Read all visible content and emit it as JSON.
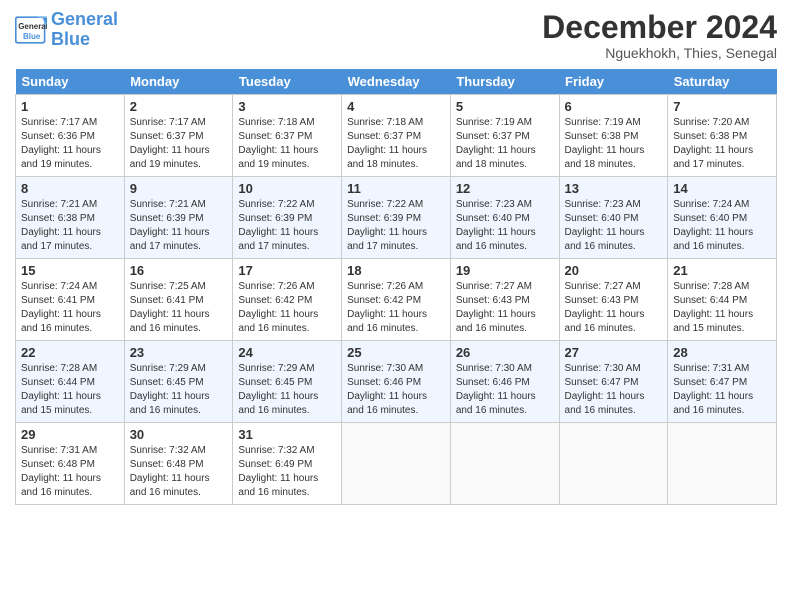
{
  "header": {
    "logo_line1": "General",
    "logo_line2": "Blue",
    "month_title": "December 2024",
    "location": "Nguekhokh, Thies, Senegal"
  },
  "days_of_week": [
    "Sunday",
    "Monday",
    "Tuesday",
    "Wednesday",
    "Thursday",
    "Friday",
    "Saturday"
  ],
  "weeks": [
    [
      {
        "day": "1",
        "info": "Sunrise: 7:17 AM\nSunset: 6:36 PM\nDaylight: 11 hours\nand 19 minutes."
      },
      {
        "day": "2",
        "info": "Sunrise: 7:17 AM\nSunset: 6:37 PM\nDaylight: 11 hours\nand 19 minutes."
      },
      {
        "day": "3",
        "info": "Sunrise: 7:18 AM\nSunset: 6:37 PM\nDaylight: 11 hours\nand 19 minutes."
      },
      {
        "day": "4",
        "info": "Sunrise: 7:18 AM\nSunset: 6:37 PM\nDaylight: 11 hours\nand 18 minutes."
      },
      {
        "day": "5",
        "info": "Sunrise: 7:19 AM\nSunset: 6:37 PM\nDaylight: 11 hours\nand 18 minutes."
      },
      {
        "day": "6",
        "info": "Sunrise: 7:19 AM\nSunset: 6:38 PM\nDaylight: 11 hours\nand 18 minutes."
      },
      {
        "day": "7",
        "info": "Sunrise: 7:20 AM\nSunset: 6:38 PM\nDaylight: 11 hours\nand 17 minutes."
      }
    ],
    [
      {
        "day": "8",
        "info": "Sunrise: 7:21 AM\nSunset: 6:38 PM\nDaylight: 11 hours\nand 17 minutes."
      },
      {
        "day": "9",
        "info": "Sunrise: 7:21 AM\nSunset: 6:39 PM\nDaylight: 11 hours\nand 17 minutes."
      },
      {
        "day": "10",
        "info": "Sunrise: 7:22 AM\nSunset: 6:39 PM\nDaylight: 11 hours\nand 17 minutes."
      },
      {
        "day": "11",
        "info": "Sunrise: 7:22 AM\nSunset: 6:39 PM\nDaylight: 11 hours\nand 17 minutes."
      },
      {
        "day": "12",
        "info": "Sunrise: 7:23 AM\nSunset: 6:40 PM\nDaylight: 11 hours\nand 16 minutes."
      },
      {
        "day": "13",
        "info": "Sunrise: 7:23 AM\nSunset: 6:40 PM\nDaylight: 11 hours\nand 16 minutes."
      },
      {
        "day": "14",
        "info": "Sunrise: 7:24 AM\nSunset: 6:40 PM\nDaylight: 11 hours\nand 16 minutes."
      }
    ],
    [
      {
        "day": "15",
        "info": "Sunrise: 7:24 AM\nSunset: 6:41 PM\nDaylight: 11 hours\nand 16 minutes."
      },
      {
        "day": "16",
        "info": "Sunrise: 7:25 AM\nSunset: 6:41 PM\nDaylight: 11 hours\nand 16 minutes."
      },
      {
        "day": "17",
        "info": "Sunrise: 7:26 AM\nSunset: 6:42 PM\nDaylight: 11 hours\nand 16 minutes."
      },
      {
        "day": "18",
        "info": "Sunrise: 7:26 AM\nSunset: 6:42 PM\nDaylight: 11 hours\nand 16 minutes."
      },
      {
        "day": "19",
        "info": "Sunrise: 7:27 AM\nSunset: 6:43 PM\nDaylight: 11 hours\nand 16 minutes."
      },
      {
        "day": "20",
        "info": "Sunrise: 7:27 AM\nSunset: 6:43 PM\nDaylight: 11 hours\nand 16 minutes."
      },
      {
        "day": "21",
        "info": "Sunrise: 7:28 AM\nSunset: 6:44 PM\nDaylight: 11 hours\nand 15 minutes."
      }
    ],
    [
      {
        "day": "22",
        "info": "Sunrise: 7:28 AM\nSunset: 6:44 PM\nDaylight: 11 hours\nand 15 minutes."
      },
      {
        "day": "23",
        "info": "Sunrise: 7:29 AM\nSunset: 6:45 PM\nDaylight: 11 hours\nand 16 minutes."
      },
      {
        "day": "24",
        "info": "Sunrise: 7:29 AM\nSunset: 6:45 PM\nDaylight: 11 hours\nand 16 minutes."
      },
      {
        "day": "25",
        "info": "Sunrise: 7:30 AM\nSunset: 6:46 PM\nDaylight: 11 hours\nand 16 minutes."
      },
      {
        "day": "26",
        "info": "Sunrise: 7:30 AM\nSunset: 6:46 PM\nDaylight: 11 hours\nand 16 minutes."
      },
      {
        "day": "27",
        "info": "Sunrise: 7:30 AM\nSunset: 6:47 PM\nDaylight: 11 hours\nand 16 minutes."
      },
      {
        "day": "28",
        "info": "Sunrise: 7:31 AM\nSunset: 6:47 PM\nDaylight: 11 hours\nand 16 minutes."
      }
    ],
    [
      {
        "day": "29",
        "info": "Sunrise: 7:31 AM\nSunset: 6:48 PM\nDaylight: 11 hours\nand 16 minutes."
      },
      {
        "day": "30",
        "info": "Sunrise: 7:32 AM\nSunset: 6:48 PM\nDaylight: 11 hours\nand 16 minutes."
      },
      {
        "day": "31",
        "info": "Sunrise: 7:32 AM\nSunset: 6:49 PM\nDaylight: 11 hours\nand 16 minutes."
      },
      null,
      null,
      null,
      null
    ]
  ]
}
